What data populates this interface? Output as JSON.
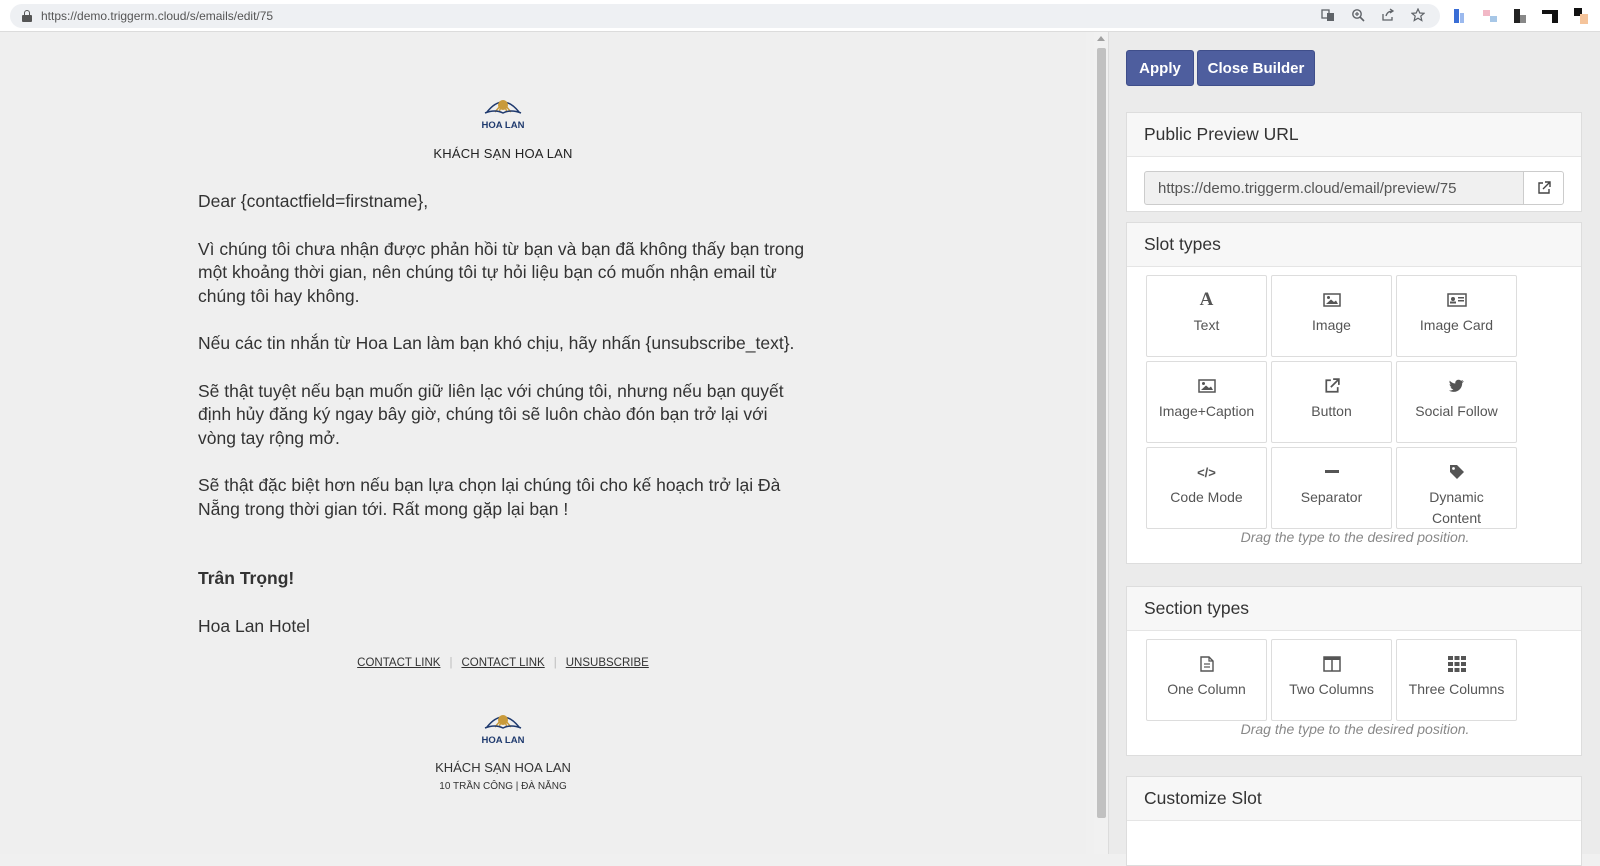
{
  "browser": {
    "url": "https://demo.triggerm.cloud/s/emails/edit/75",
    "icons": [
      "translate-icon",
      "zoom-icon",
      "share-icon",
      "star-icon"
    ]
  },
  "email": {
    "logo_text": "HOA LAN",
    "hotel_name": "KHÁCH SẠN HOA LAN",
    "greeting": "Dear {contactfield=firstname},",
    "paragraphs": [
      "Vì chúng tôi chưa nhận được phản hồi từ bạn và bạn đã không thấy bạn trong một khoảng thời gian, nên chúng tôi tự hỏi liệu bạn có muốn nhận email từ chúng tôi hay không.",
      "Nếu các tin nhắn từ Hoa Lan làm bạn khó chịu, hãy nhấn {unsubscribe_text}.",
      "Sẽ thật tuyệt nếu bạn muốn giữ liên lạc với chúng tôi, nhưng nếu bạn quyết định hủy đăng ký ngay bây giờ, chúng tôi sẽ luôn chào đón bạn trở lại với vòng tay rộng mở.",
      "Sẽ thật đặc biệt hơn nếu bạn lựa chọn lại chúng tôi cho kế hoạch trở lại Đà Nẵng trong thời gian tới. Rất mong gặp lại bạn !"
    ],
    "signoff": "Trân Trọng!",
    "signature": "Hoa Lan Hotel",
    "footer_links": [
      "CONTACT LINK",
      "CONTACT LINK",
      "UNSUBSCRIBE"
    ],
    "footer_name": "KHÁCH SẠN HOA LAN",
    "footer_address": "10 TRẦN CÔNG | ĐÀ NẴNG"
  },
  "panel": {
    "apply_label": "Apply",
    "close_label": "Close Builder",
    "preview": {
      "title": "Public Preview URL",
      "url": "https://demo.triggerm.cloud/email/preview/75"
    },
    "slot_types": {
      "title": "Slot types",
      "items": [
        {
          "label": "Text",
          "icon": "text-icon"
        },
        {
          "label": "Image",
          "icon": "image-icon"
        },
        {
          "label": "Image Card",
          "icon": "id-card-icon"
        },
        {
          "label": "Image+Caption",
          "icon": "image-caption-icon"
        },
        {
          "label": "Button",
          "icon": "external-link-icon"
        },
        {
          "label": "Social Follow",
          "icon": "twitter-icon"
        },
        {
          "label": "Code Mode",
          "icon": "code-icon"
        },
        {
          "label": "Separator",
          "icon": "minus-icon"
        },
        {
          "label": "Dynamic Content",
          "icon": "tag-icon"
        }
      ],
      "hint": "Drag the type to the desired position."
    },
    "section_types": {
      "title": "Section types",
      "items": [
        {
          "label": "One Column",
          "icon": "file-icon"
        },
        {
          "label": "Two Columns",
          "icon": "columns-icon"
        },
        {
          "label": "Three Columns",
          "icon": "grid-icon"
        }
      ],
      "hint": "Drag the type to the desired position."
    },
    "customize_title": "Customize Slot"
  },
  "colors": {
    "primary_button": "#4e5e9e",
    "logo_navy": "#1f3a6e",
    "logo_gold": "#c99a3a"
  }
}
